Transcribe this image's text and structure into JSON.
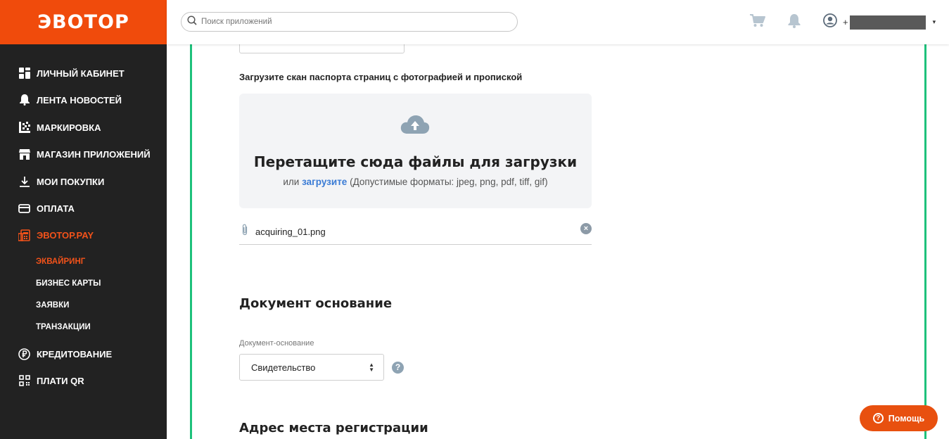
{
  "brand": {
    "logo_text": "ЭВОТОР",
    "logo_color": "#f04b0c",
    "accent": "#1ec17b"
  },
  "header": {
    "search_placeholder": "Поиск приложений",
    "user_prefix": "+",
    "user_caret": "▾"
  },
  "sidebar": {
    "items": [
      {
        "label": "ЛИЧНЫЙ КАБИНЕТ",
        "icon": "dashboard-icon"
      },
      {
        "label": "ЛЕНТА НОВОСТЕЙ",
        "icon": "bell-icon"
      },
      {
        "label": "МАРКИРОВКА",
        "icon": "datamatrix-icon"
      },
      {
        "label": "МАГАЗИН ПРИЛОЖЕНИЙ",
        "icon": "store-icon"
      },
      {
        "label": "МОИ ПОКУПКИ",
        "icon": "download-icon"
      },
      {
        "label": "ОПЛАТА",
        "icon": "card-icon"
      },
      {
        "label": "ЭВОТОР.PAY",
        "icon": "terminal-icon"
      },
      {
        "label": "КРЕДИТОВАНИЕ",
        "icon": "ruble-icon"
      },
      {
        "label": "ПЛАТИ QR",
        "icon": "qr-icon"
      }
    ],
    "sub_items": [
      {
        "label": "ЭКВАЙРИНГ"
      },
      {
        "label": "БИЗНЕС КАРТЫ"
      },
      {
        "label": "ЗАЯВКИ"
      },
      {
        "label": "ТРАНЗАКЦИИ"
      }
    ]
  },
  "upload": {
    "label": "Загрузите скан паспорта страниц с фотографией и пропиской",
    "drop_title": "Перетащите сюда файлы для загрузки",
    "hint_prefix": "или",
    "hint_link": "загрузите",
    "hint_suffix": "(Допустимые форматы: jpeg, png, pdf, tiff, gif)",
    "file_name": "acquiring_01.png"
  },
  "document_section": {
    "title": "Документ основание",
    "field_label": "Документ-основание",
    "selected": "Свидетельство",
    "help": "?"
  },
  "address_section": {
    "title": "Адрес места регистрации"
  },
  "help_button": {
    "label": "Помощь",
    "icon_text": "?"
  }
}
